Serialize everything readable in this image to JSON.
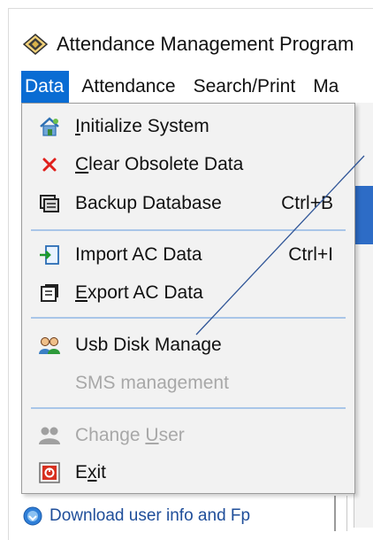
{
  "window": {
    "title": "Attendance Management Program"
  },
  "menubar": {
    "items": [
      {
        "label": "Data",
        "active": true
      },
      {
        "label": "Attendance",
        "active": false
      },
      {
        "label": "Search/Print",
        "active": false
      },
      {
        "label": "Ma",
        "active": false
      }
    ]
  },
  "data_menu": {
    "items": [
      {
        "pre": "",
        "u": "I",
        "post": "nitialize System",
        "shortcut": "",
        "icon": "house-icon",
        "disabled": false
      },
      {
        "pre": "",
        "u": "C",
        "post": "lear Obsolete Data",
        "shortcut": "",
        "icon": "red-x-icon",
        "disabled": false
      },
      {
        "pre": "Backup Database",
        "u": "",
        "post": "",
        "shortcut": "Ctrl+B",
        "icon": "database-backup-icon",
        "disabled": false
      },
      {
        "pre": "Import AC Data",
        "u": "",
        "post": "",
        "shortcut": "Ctrl+I",
        "icon": "import-icon",
        "disabled": false
      },
      {
        "pre": "",
        "u": "E",
        "post": "xport AC Data",
        "shortcut": "",
        "icon": "export-icon",
        "disabled": false
      },
      {
        "pre": "Usb Disk Manage",
        "u": "",
        "post": "",
        "shortcut": "",
        "icon": "users-icon",
        "disabled": false
      },
      {
        "pre": "SMS management",
        "u": "",
        "post": "",
        "shortcut": "",
        "icon": "",
        "disabled": true
      },
      {
        "pre": "Change ",
        "u": "U",
        "post": "ser",
        "shortcut": "",
        "icon": "change-user-icon",
        "disabled": true
      },
      {
        "pre": "E",
        "u": "x",
        "post": "it",
        "shortcut": "",
        "icon": "exit-icon",
        "disabled": false
      }
    ]
  },
  "background": {
    "bottom_link": "Download user info and Fp"
  },
  "colors": {
    "menu_highlight": "#0a6cd3",
    "separator": "#a9c6e8",
    "disabled_text": "#a8a8a8",
    "link": "#1f4e9a",
    "annotation_line": "#2f5597"
  }
}
